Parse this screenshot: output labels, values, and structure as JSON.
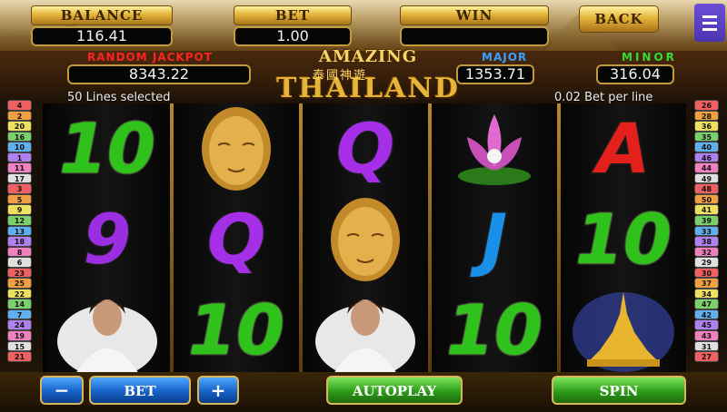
{
  "top": {
    "balance_label": "BALANCE",
    "balance_value": "116.41",
    "bet_label": "BET",
    "bet_value": "1.00",
    "win_label": "WIN",
    "win_value": "",
    "back_label": "BACK"
  },
  "jackpots": {
    "random": {
      "label": "RANDOM  JACKPOT",
      "value": "8343.22"
    },
    "major": {
      "label": "MAJOR",
      "value": "1353.71"
    },
    "minor": {
      "label": "MINOR",
      "value": "316.04"
    }
  },
  "logo": {
    "line1": "AMAZING",
    "line2": "THAILAND",
    "chinese": "泰國神遊"
  },
  "info": {
    "lines_selected": "50 Lines selected",
    "bet_per_line": "0.02 Bet per line"
  },
  "paylines": {
    "left": [
      "4",
      "2",
      "20",
      "16",
      "10",
      "1",
      "11",
      "17",
      "3",
      "5",
      "9",
      "12",
      "13",
      "18",
      "8",
      "6",
      "23",
      "25",
      "22",
      "14",
      "7",
      "24",
      "19",
      "15",
      "21"
    ],
    "right": [
      "26",
      "28",
      "36",
      "35",
      "40",
      "46",
      "44",
      "49",
      "48",
      "50",
      "41",
      "39",
      "33",
      "38",
      "32",
      "29",
      "30",
      "37",
      "34",
      "47",
      "42",
      "45",
      "43",
      "31",
      "27"
    ]
  },
  "reels": [
    [
      "10",
      "buddha-face",
      "lady-portrait"
    ],
    [
      "9",
      "Q",
      "10"
    ],
    [
      "Q",
      "buddha-face",
      "lady-portrait"
    ],
    [
      "lotus-flower",
      "J",
      "10"
    ],
    [
      "A",
      "10",
      "golden-stupa"
    ]
  ],
  "reel_symbols_display": [
    [
      "10",
      "",
      ""
    ],
    [
      "9",
      "Q",
      "10"
    ],
    [
      "Q",
      "",
      ""
    ],
    [
      "",
      "J",
      "10"
    ],
    [
      "A",
      "10",
      ""
    ]
  ],
  "bottom": {
    "minus_label": "−",
    "bet_label": "BET",
    "plus_label": "+",
    "autoplay_label": "AUTOPLAY",
    "spin_label": "SPIN"
  },
  "colors": {
    "gold": "#e5b53a",
    "green_button": "#2e9d1a",
    "blue_button": "#1761c8",
    "random_jackpot_label": "#ff2222",
    "major_label": "#3aa0ff",
    "minor_label": "#33dd33"
  }
}
